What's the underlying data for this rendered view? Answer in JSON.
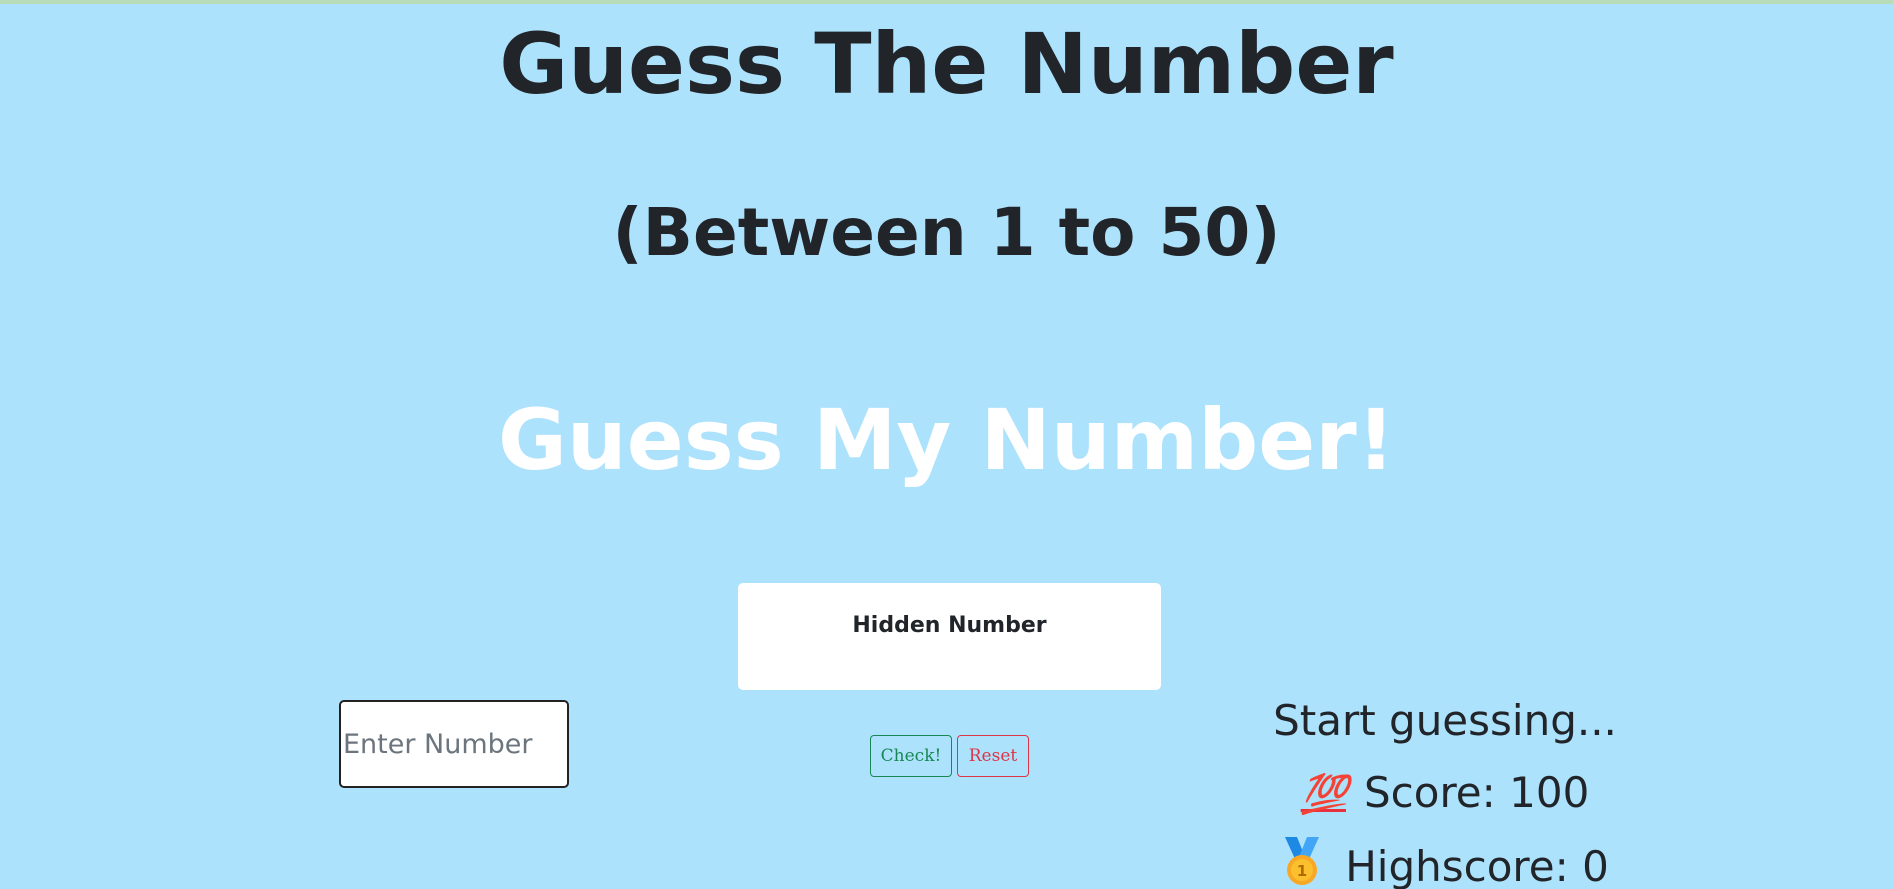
{
  "header": {
    "title": "Guess The Number",
    "subtitle": "(Between 1 to 50)"
  },
  "main": {
    "headline": "Guess My Number!",
    "hidden_number_label": "Hidden Number"
  },
  "input": {
    "value": "",
    "placeholder": "Enter Number"
  },
  "buttons": {
    "check_label": "Check!",
    "reset_label": "Reset"
  },
  "status": {
    "message": "Start guessing...",
    "score_emoji": "💯",
    "score_text": "Score: 100",
    "highscore_text": "Highscore: 0",
    "highscore_icon": "first-place-medal-icon"
  },
  "colors": {
    "background": "#ade2fd",
    "text": "#212529",
    "headline": "#ffffff",
    "check_button": "#198754",
    "reset_button": "#dc3545"
  }
}
